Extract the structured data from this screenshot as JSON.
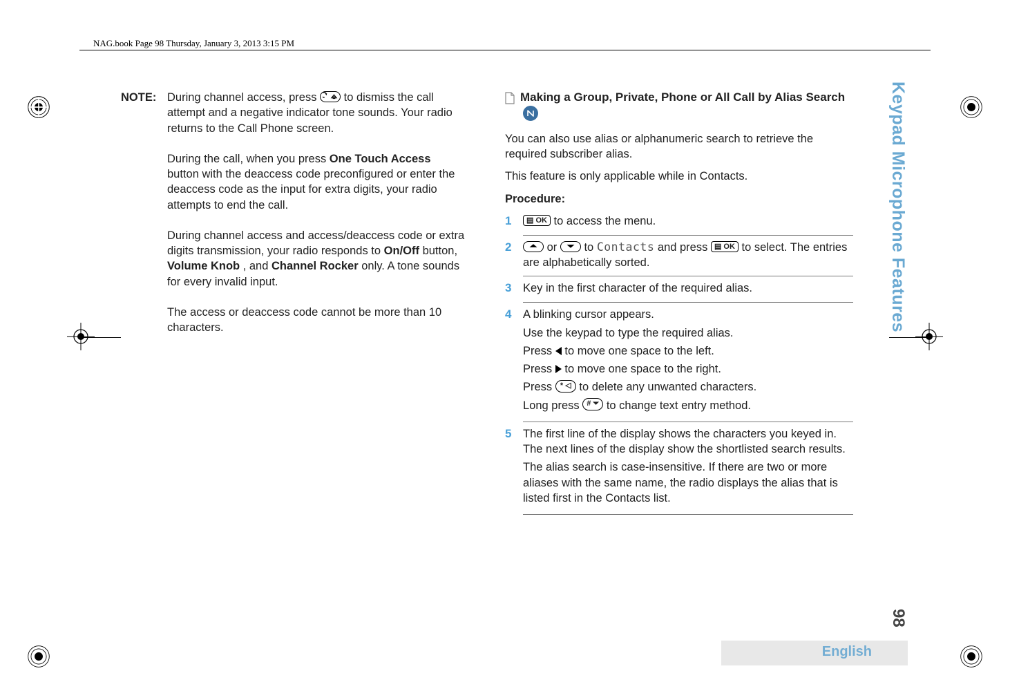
{
  "header": {
    "running": "NAG.book  Page 98  Thursday, January 3, 2013  3:15 PM"
  },
  "left": {
    "note_label": "NOTE:",
    "p1a": "During channel access, press ",
    "p1b": " to dismiss the call attempt and a negative indicator tone sounds. Your radio returns to the Call Phone screen.",
    "p2a": "During the call, when you press ",
    "p2b": "One Touch Access",
    "p2c": " button with the deaccess code preconfigured or enter the deaccess code as the input for extra digits, your radio attempts to end the call.",
    "p3a": "During channel access and access/deaccess code or extra digits transmission, your radio responds to ",
    "p3b": "On/Off",
    "p3c": " button, ",
    "p3d": "Volume Knob",
    "p3e": ", and ",
    "p3f": "Channel Rocker",
    "p3g": " only. A tone sounds for every invalid input.",
    "p4": "The access or deaccess code cannot be more than 10 characters."
  },
  "right": {
    "heading": "Making a Group, Private, Phone or All Call by Alias Search ",
    "intro1": "You can also use alias or alphanumeric search to retrieve the required subscriber alias.",
    "intro2": "This feature is only applicable while in Contacts.",
    "procedure_label": "Procedure:",
    "s1a": " to access the menu.",
    "s2a": " or ",
    "s2b": " to ",
    "s2c": "Contacts",
    "s2d": " and press ",
    "s2e": " to select. The entries are alphabetically sorted.",
    "s3": "Key in the first character of the required alias.",
    "s4a": "A blinking cursor appears.",
    "s4b": "Use the keypad to type the required alias.",
    "s4c1": "Press ",
    "s4c2": " to move one space to the left.",
    "s4d1": "Press ",
    "s4d2": " to move one space to the right.",
    "s4e1": "Press ",
    "s4e2": " to delete any unwanted characters.",
    "s4f1": "Long press ",
    "s4f2": " to change text entry method.",
    "s5a": "The first line of the display shows the characters you keyed in. The next lines of the display show the shortlisted search results.",
    "s5b": "The alias search is case-insensitive. If there are two or more aliases with the same name, the radio displays the alias that is listed first in the Contacts list."
  },
  "keys": {
    "back": "⤺⌂",
    "ok": "▤ OK",
    "star": "* ◁",
    "hash": "# ⏷"
  },
  "side": {
    "label": "Keypad Microphone Features",
    "page": "98"
  },
  "footer": {
    "lang": "English"
  }
}
